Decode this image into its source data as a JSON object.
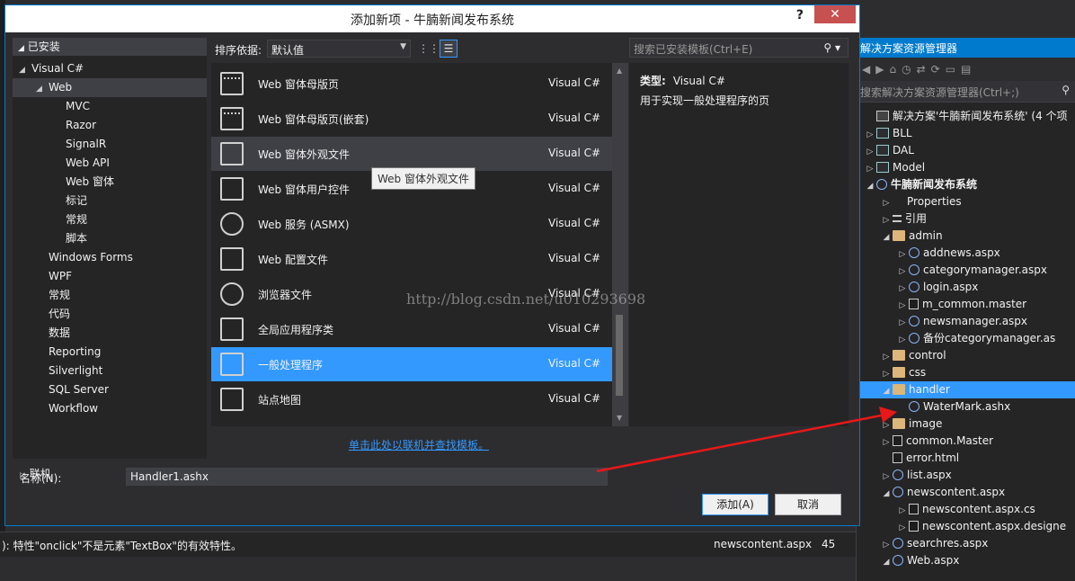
{
  "dialog": {
    "title": "添加新项 - 牛腩新闻发布系统",
    "help": "?",
    "close": "✕",
    "installed": "已安装",
    "sort_label": "排序依据:",
    "sort_value": "默认值",
    "search_placeholder": "搜索已安装模板(Ctrl+E)",
    "detail_type_label": "类型:",
    "detail_type_value": "Visual C#",
    "detail_desc": "用于实现一般处理程序的页",
    "tooltip": "Web 窗体外观文件",
    "online_link": "单击此处以联机并查找模板。",
    "online_node": "联机",
    "name_label": "名称(N):",
    "name_value": "Handler1.ashx",
    "add_button": "添加(A)",
    "cancel_button": "取消"
  },
  "nav_tree": [
    {
      "label": "Visual C#",
      "indent": 1,
      "arrow": "◢"
    },
    {
      "label": "Web",
      "indent": 2,
      "arrow": "◢",
      "selected": true
    },
    {
      "label": "MVC",
      "indent": 3
    },
    {
      "label": "Razor",
      "indent": 3
    },
    {
      "label": "SignalR",
      "indent": 3
    },
    {
      "label": "Web API",
      "indent": 3
    },
    {
      "label": "Web 窗体",
      "indent": 3
    },
    {
      "label": "标记",
      "indent": 3
    },
    {
      "label": "常规",
      "indent": 3
    },
    {
      "label": "脚本",
      "indent": 3
    },
    {
      "label": "Windows Forms",
      "indent": 2
    },
    {
      "label": "WPF",
      "indent": 2
    },
    {
      "label": "常规",
      "indent": 2
    },
    {
      "label": "代码",
      "indent": 2
    },
    {
      "label": "数据",
      "indent": 2
    },
    {
      "label": "Reporting",
      "indent": 2
    },
    {
      "label": "Silverlight",
      "indent": 2
    },
    {
      "label": "SQL Server",
      "indent": 2
    },
    {
      "label": "Workflow",
      "indent": 2
    }
  ],
  "templates": [
    {
      "name": "Web 窗体母版页",
      "lang": "Visual C#",
      "icon": "master-page-icon"
    },
    {
      "name": "Web 窗体母版页(嵌套)",
      "lang": "Visual C#",
      "icon": "nested-master-page-icon"
    },
    {
      "name": "Web 窗体外观文件",
      "lang": "Visual C#",
      "icon": "skin-file-icon",
      "state": "hover"
    },
    {
      "name": "Web 窗体用户控件",
      "lang": "Visual C#",
      "icon": "user-control-icon"
    },
    {
      "name": "Web 服务 (ASMX)",
      "lang": "Visual C#",
      "icon": "web-service-icon"
    },
    {
      "name": "Web 配置文件",
      "lang": "Visual C#",
      "icon": "config-file-icon"
    },
    {
      "name": "浏览器文件",
      "lang": "Visual C#",
      "icon": "browser-file-icon"
    },
    {
      "name": "全局应用程序类",
      "lang": "Visual C#",
      "icon": "global-app-icon"
    },
    {
      "name": "一般处理程序",
      "lang": "Visual C#",
      "icon": "generic-handler-icon",
      "state": "selected"
    },
    {
      "name": "站点地图",
      "lang": "Visual C#",
      "icon": "sitemap-icon"
    }
  ],
  "solution_explorer": {
    "title": "解决方案资源管理器",
    "search_placeholder": "搜索解决方案资源管理器(Ctrl+;)",
    "items": [
      {
        "label": "解决方案'牛腩新闻发布系统' (4 个项",
        "depth": 0,
        "arrow": "",
        "icon": "sln"
      },
      {
        "label": "BLL",
        "depth": 0,
        "arrow": "▷",
        "icon": "proj"
      },
      {
        "label": "DAL",
        "depth": 0,
        "arrow": "▷",
        "icon": "proj"
      },
      {
        "label": "Model",
        "depth": 0,
        "arrow": "▷",
        "icon": "proj"
      },
      {
        "label": "牛腩新闻发布系统",
        "depth": 0,
        "arrow": "◢",
        "icon": "globe",
        "bold": true
      },
      {
        "label": "Properties",
        "depth": 1,
        "arrow": "▷",
        "icon": "wrench"
      },
      {
        "label": "引用",
        "depth": 1,
        "arrow": "▷",
        "icon": "ref"
      },
      {
        "label": "admin",
        "depth": 1,
        "arrow": "◢",
        "icon": "folder"
      },
      {
        "label": "addnews.aspx",
        "depth": 2,
        "arrow": "▷",
        "icon": "globe"
      },
      {
        "label": "categorymanager.aspx",
        "depth": 2,
        "arrow": "▷",
        "icon": "globe"
      },
      {
        "label": "login.aspx",
        "depth": 2,
        "arrow": "▷",
        "icon": "globe"
      },
      {
        "label": "m_common.master",
        "depth": 2,
        "arrow": "▷",
        "icon": "file"
      },
      {
        "label": "newsmanager.aspx",
        "depth": 2,
        "arrow": "▷",
        "icon": "globe"
      },
      {
        "label": "备份categorymanager.as",
        "depth": 2,
        "arrow": "▷",
        "icon": "globe"
      },
      {
        "label": "control",
        "depth": 1,
        "arrow": "▷",
        "icon": "folder"
      },
      {
        "label": "css",
        "depth": 1,
        "arrow": "▷",
        "icon": "folder"
      },
      {
        "label": "handler",
        "depth": 1,
        "arrow": "◢",
        "icon": "folder",
        "selected": true
      },
      {
        "label": "WaterMark.ashx",
        "depth": 2,
        "arrow": "",
        "icon": "globe"
      },
      {
        "label": "image",
        "depth": 1,
        "arrow": "▷",
        "icon": "folder"
      },
      {
        "label": "common.Master",
        "depth": 1,
        "arrow": "▷",
        "icon": "file"
      },
      {
        "label": "error.html",
        "depth": 1,
        "arrow": "",
        "icon": "file"
      },
      {
        "label": "list.aspx",
        "depth": 1,
        "arrow": "▷",
        "icon": "globe"
      },
      {
        "label": "newscontent.aspx",
        "depth": 1,
        "arrow": "◢",
        "icon": "globe"
      },
      {
        "label": "newscontent.aspx.cs",
        "depth": 2,
        "arrow": "▷",
        "icon": "file"
      },
      {
        "label": "newscontent.aspx.designe",
        "depth": 2,
        "arrow": "▷",
        "icon": "file"
      },
      {
        "label": "searchres.aspx",
        "depth": 1,
        "arrow": "▷",
        "icon": "globe"
      },
      {
        "label": "Web.aspx",
        "depth": 1,
        "arrow": "◢",
        "icon": "globe"
      }
    ]
  },
  "statusbar": {
    "message": "): 特性\"onclick\"不是元素\"TextBox\"的有效特性。",
    "file": "newscontent.aspx",
    "line": "45"
  },
  "watermark": "http://blog.csdn.net/u010293698",
  "colors": {
    "accent": "#007acc",
    "selection": "#3399ff",
    "dialog_bg": "#2d2d30",
    "arrow": "#e81818"
  }
}
